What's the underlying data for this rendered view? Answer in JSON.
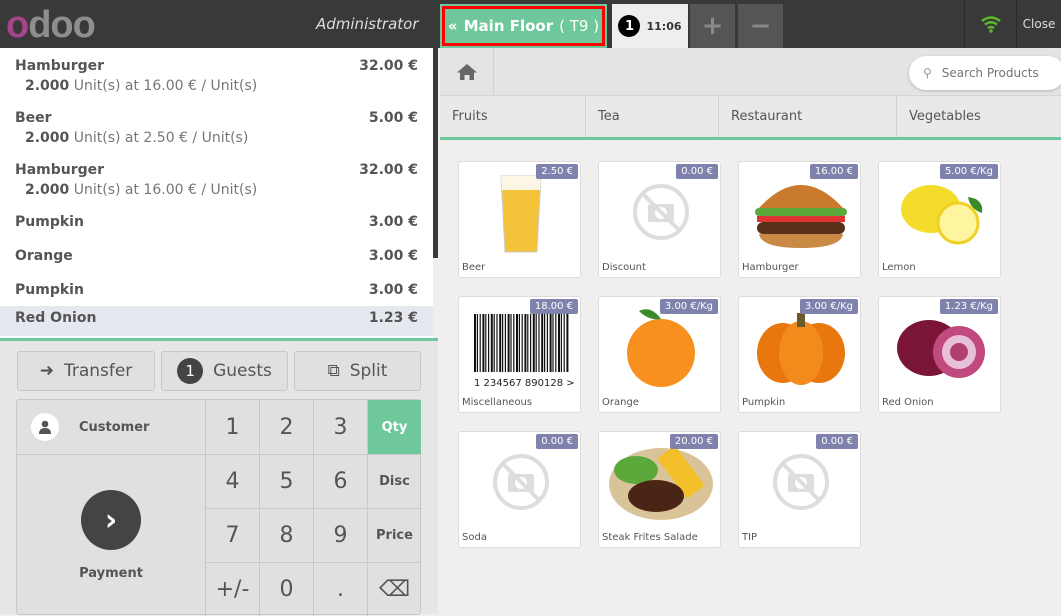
{
  "header": {
    "logo": "odoo",
    "user": "Administrator",
    "floor_button": "Main Floor",
    "table": "( T9 )",
    "order_number": "1",
    "order_time": "11:06",
    "add_order": "+",
    "remove_order": "−",
    "close": "Close",
    "wifi_color": "#5cb82c"
  },
  "order": {
    "lines": [
      {
        "name": "Hamburger",
        "price": "32.00 €",
        "qty": "2.000",
        "info": "Unit(s) at 16.00 € / Unit(s)"
      },
      {
        "name": "Beer",
        "price": "5.00 €",
        "qty": "2.000",
        "info": "Unit(s) at 2.50 € / Unit(s)"
      },
      {
        "name": "Hamburger",
        "price": "32.00 €",
        "qty": "2.000",
        "info": "Unit(s) at 16.00 € / Unit(s)"
      },
      {
        "name": "Pumpkin",
        "price": "3.00 €"
      },
      {
        "name": "Orange",
        "price": "3.00 €"
      },
      {
        "name": "Pumpkin",
        "price": "3.00 €"
      },
      {
        "name": "Red Onion",
        "price": "1.23 €",
        "selected": true
      }
    ]
  },
  "controls": {
    "transfer": "Transfer",
    "guests_count": "1",
    "guests": "Guests",
    "split": "Split"
  },
  "numpad": {
    "customer": "Customer",
    "payment": "Payment",
    "keys": [
      "1",
      "2",
      "3",
      "4",
      "5",
      "6",
      "7",
      "8",
      "9",
      "+/-",
      "0",
      "."
    ],
    "modes": [
      "Qty",
      "Disc",
      "Price"
    ],
    "active_mode": "Qty",
    "backspace": "⌫"
  },
  "products": {
    "search_placeholder": "Search Products",
    "categories": [
      "Fruits",
      "Tea",
      "Restaurant",
      "Vegetables"
    ],
    "items": [
      {
        "name": "Beer",
        "price": "2.50 €",
        "icon": "beer"
      },
      {
        "name": "Discount",
        "price": "0.00 €",
        "icon": "no-image"
      },
      {
        "name": "Hamburger",
        "price": "16.00 €",
        "icon": "hamburger"
      },
      {
        "name": "Lemon",
        "price": "5.00 €/Kg",
        "icon": "lemon"
      },
      {
        "name": "Miscellaneous",
        "price": "18.00 €",
        "icon": "barcode",
        "barcode": "1 234567 890128 >"
      },
      {
        "name": "Orange",
        "price": "3.00 €/Kg",
        "icon": "orange"
      },
      {
        "name": "Pumpkin",
        "price": "3.00 €/Kg",
        "icon": "pumpkin"
      },
      {
        "name": "Red Onion",
        "price": "1.23 €/Kg",
        "icon": "red-onion"
      },
      {
        "name": "Soda",
        "price": "0.00 €",
        "icon": "no-image"
      },
      {
        "name": "Steak Frites Salade",
        "price": "20.00 €",
        "icon": "steak"
      },
      {
        "name": "TIP",
        "price": "0.00 €",
        "icon": "no-image"
      }
    ]
  }
}
